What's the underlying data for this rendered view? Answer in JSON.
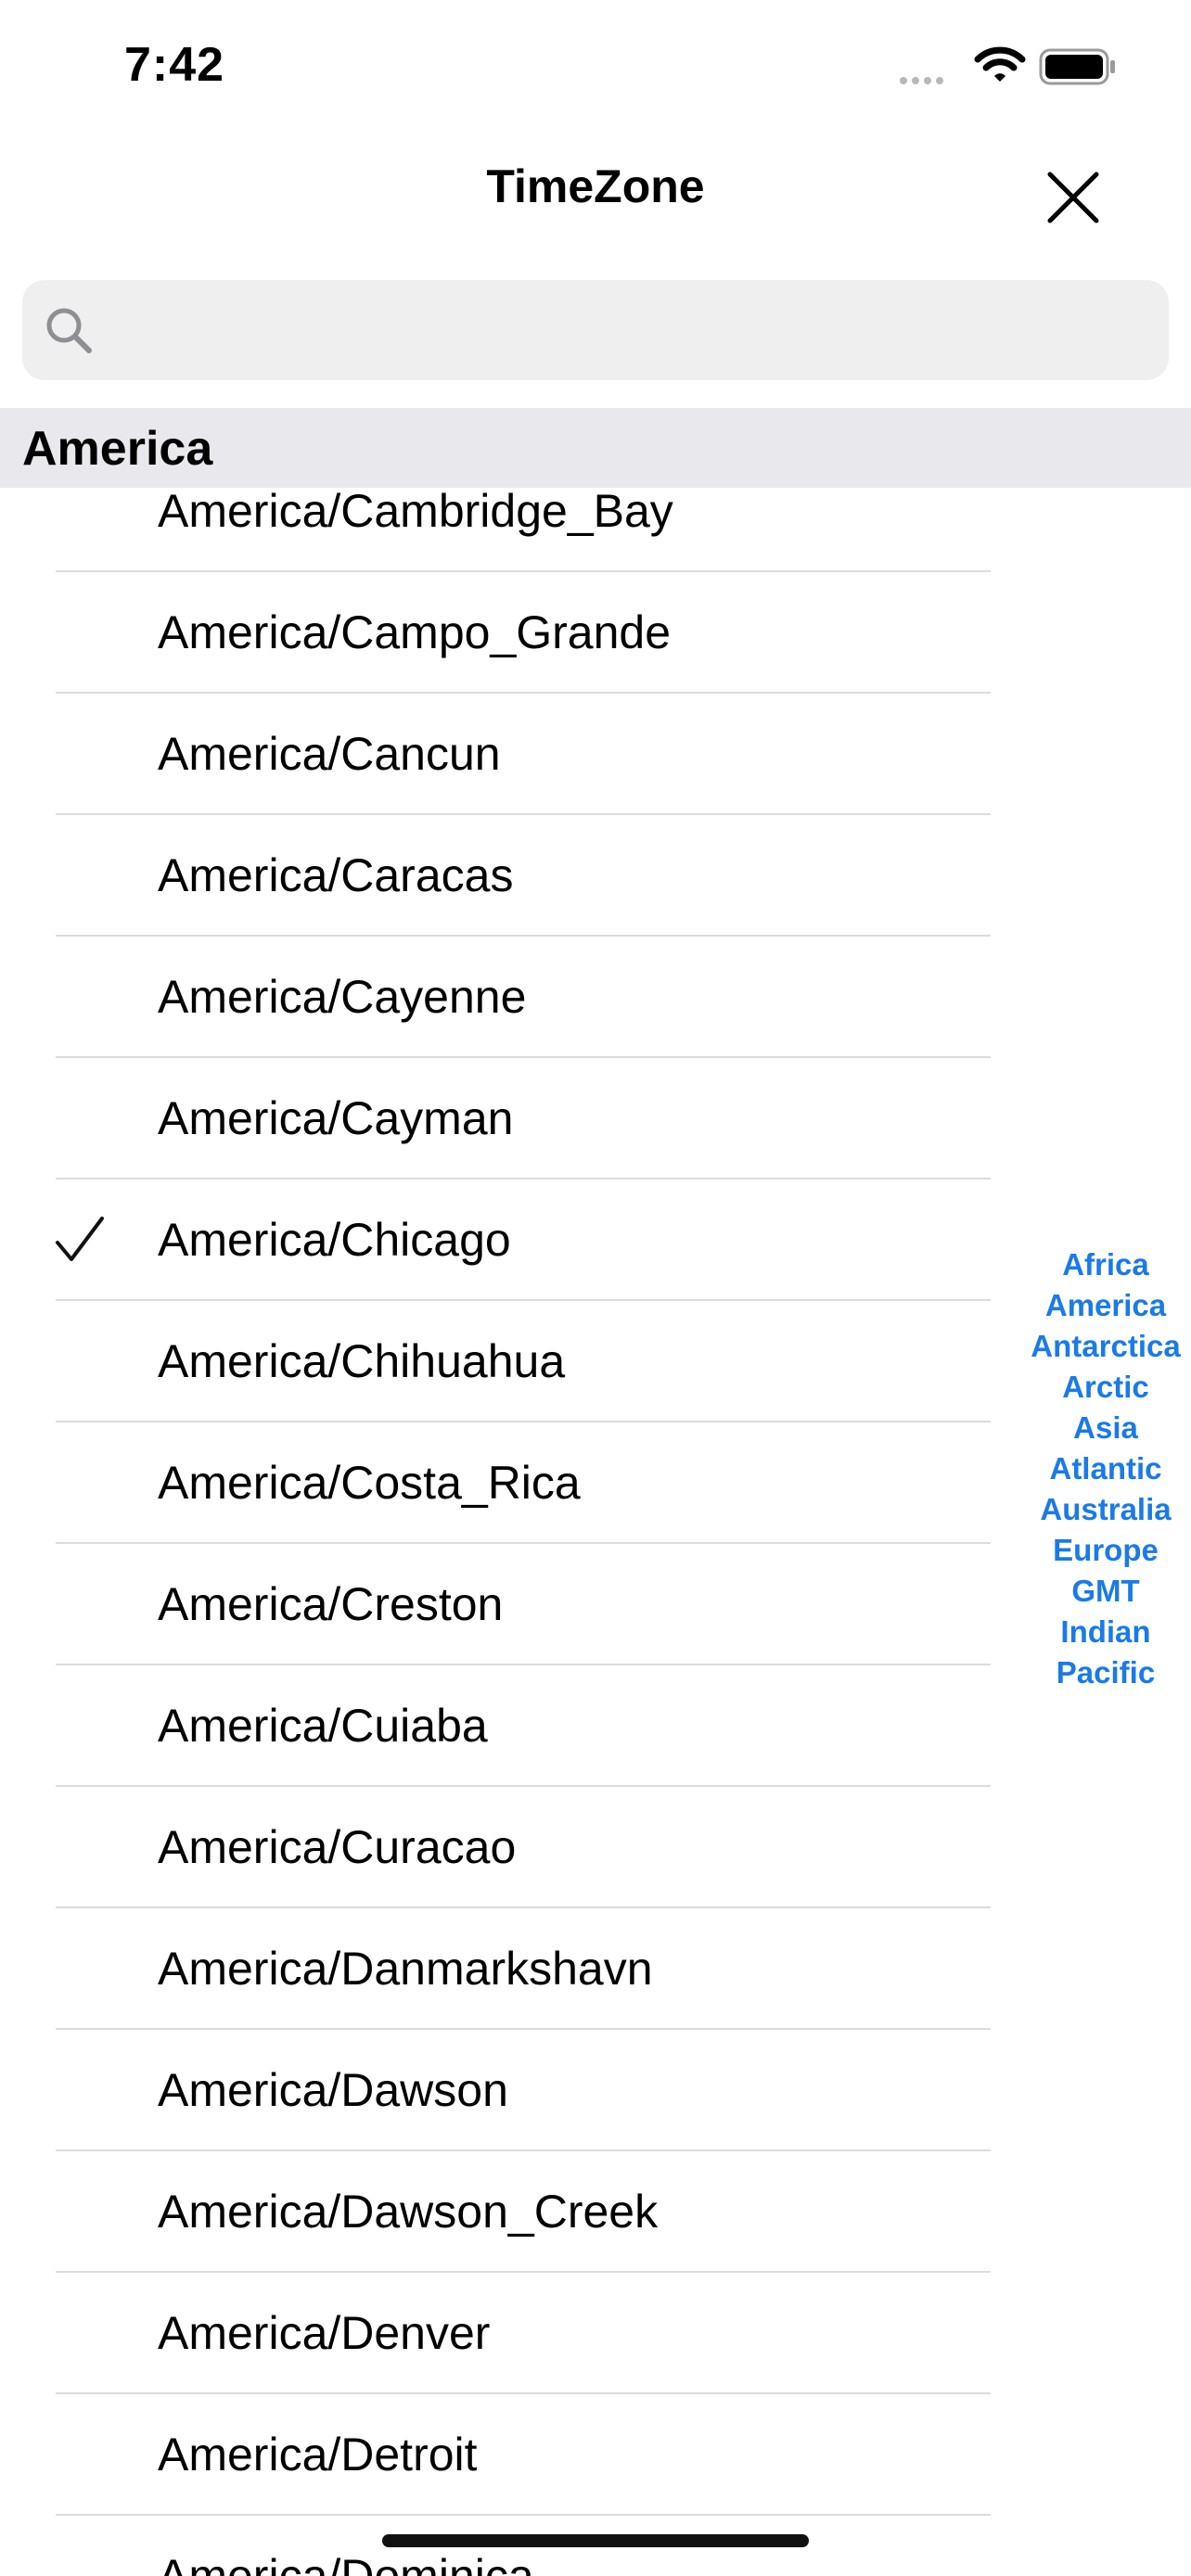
{
  "status_bar": {
    "time": "7:42"
  },
  "header": {
    "title": "TimeZone"
  },
  "search": {
    "placeholder": "",
    "value": ""
  },
  "section": {
    "title": "America"
  },
  "rows": [
    {
      "label": "America/Cambridge_Bay",
      "selected": false
    },
    {
      "label": "America/Campo_Grande",
      "selected": false
    },
    {
      "label": "America/Cancun",
      "selected": false
    },
    {
      "label": "America/Caracas",
      "selected": false
    },
    {
      "label": "America/Cayenne",
      "selected": false
    },
    {
      "label": "America/Cayman",
      "selected": false
    },
    {
      "label": "America/Chicago",
      "selected": true
    },
    {
      "label": "America/Chihuahua",
      "selected": false
    },
    {
      "label": "America/Costa_Rica",
      "selected": false
    },
    {
      "label": "America/Creston",
      "selected": false
    },
    {
      "label": "America/Cuiaba",
      "selected": false
    },
    {
      "label": "America/Curacao",
      "selected": false
    },
    {
      "label": "America/Danmarkshavn",
      "selected": false
    },
    {
      "label": "America/Dawson",
      "selected": false
    },
    {
      "label": "America/Dawson_Creek",
      "selected": false
    },
    {
      "label": "America/Denver",
      "selected": false
    },
    {
      "label": "America/Detroit",
      "selected": false
    },
    {
      "label": "America/Dominica",
      "selected": false
    }
  ],
  "section_index": [
    "Africa",
    "America",
    "Antarctica",
    "Arctic",
    "Asia",
    "Atlantic",
    "Australia",
    "Europe",
    "GMT",
    "Indian",
    "Pacific"
  ],
  "colors": {
    "accent": "#1a7ae8",
    "section_header_bg": "#e8e8ed",
    "search_bg": "#efeff0"
  }
}
